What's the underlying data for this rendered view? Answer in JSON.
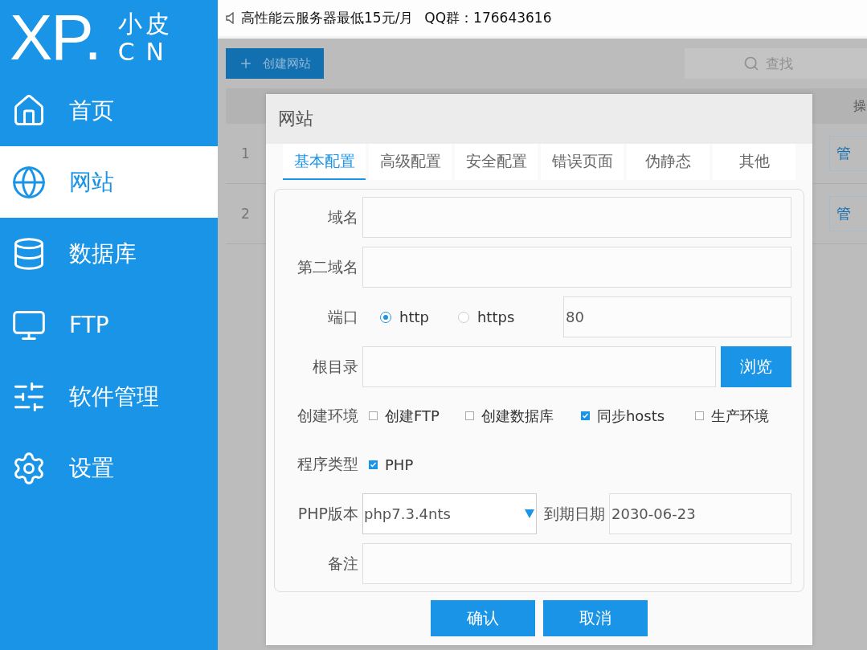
{
  "sidebar": {
    "logo": {
      "mark": "XP.",
      "top": "小皮",
      "bottom": "CN"
    },
    "items": [
      {
        "label": "首页",
        "selected": false
      },
      {
        "label": "网站",
        "selected": true
      },
      {
        "label": "数据库",
        "selected": false
      },
      {
        "label": "FTP",
        "selected": false
      },
      {
        "label": "软件管理",
        "selected": false
      },
      {
        "label": "设置",
        "selected": false
      }
    ]
  },
  "notice": [
    "高性能云服务器最低15元/月",
    "QQ群：176643616"
  ],
  "toolbar": {
    "create_button": "创建网站",
    "search": {
      "placeholder": "查找"
    }
  },
  "table": {
    "columns": {
      "column_last": "操"
    },
    "rows": [
      {
        "index": "1",
        "action": "管"
      },
      {
        "index": "2",
        "action": "管"
      }
    ]
  },
  "dialog": {
    "title": "网站",
    "tabs": [
      {
        "label": "基本配置",
        "selected": true
      },
      {
        "label": "高级配置",
        "selected": false
      },
      {
        "label": "安全配置",
        "selected": false
      },
      {
        "label": "错误页面",
        "selected": false
      },
      {
        "label": "伪静态",
        "selected": false
      },
      {
        "label": "其他",
        "selected": false
      }
    ],
    "rows": [
      {
        "kind": "input",
        "label": "域名"
      },
      {
        "kind": "input",
        "label": "第二域名"
      },
      {
        "kind": "port",
        "label": "端口",
        "options": [
          {
            "label": "http",
            "selected": true
          },
          {
            "label": "https",
            "selected": false
          }
        ],
        "value": "80"
      },
      {
        "kind": "browse",
        "label": "根目录",
        "button": "浏览"
      },
      {
        "kind": "checks",
        "label": "创建环境",
        "options": [
          {
            "label": "创建FTP",
            "checked": false
          },
          {
            "label": "创建数据库",
            "checked": false
          },
          {
            "label": "同步hosts",
            "checked": true
          },
          {
            "label": "生产环境",
            "checked": false
          }
        ]
      },
      {
        "kind": "checks",
        "label": "程序类型",
        "options": [
          {
            "label": "PHP",
            "checked": true
          }
        ]
      },
      {
        "kind": "version",
        "label": "PHP版本",
        "value": "php7.3.4nts",
        "date_label": "到期日期",
        "date": "2030-06-23"
      },
      {
        "kind": "input",
        "label": "备注"
      }
    ],
    "buttons": [
      "确认",
      "取消"
    ]
  }
}
